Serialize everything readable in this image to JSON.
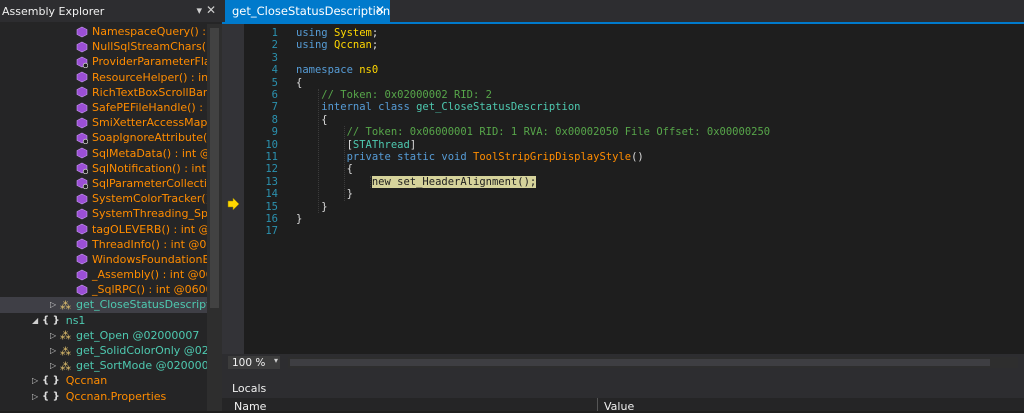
{
  "assembly_explorer": {
    "title": "Assembly Explorer",
    "items": [
      {
        "label": "NamespaceQuery() : in",
        "color": "orange",
        "indent": 0,
        "icon": "method-icon"
      },
      {
        "label": "NullSqlStreamChars() :",
        "color": "orange",
        "indent": 0,
        "icon": "method-icon"
      },
      {
        "label": "ProviderParameterFlag",
        "color": "orange",
        "indent": 0,
        "icon": "class-ref-icon"
      },
      {
        "label": "ResourceHelper() : int",
        "color": "orange",
        "indent": 0,
        "icon": "method-icon"
      },
      {
        "label": "RichTextBoxScrollBars",
        "color": "orange",
        "indent": 0,
        "icon": "method-icon"
      },
      {
        "label": "SafePEFileHandle() : st",
        "color": "orange",
        "indent": 0,
        "icon": "method-icon"
      },
      {
        "label": "SmiXetterAccessMap(",
        "color": "orange",
        "indent": 0,
        "icon": "method-icon"
      },
      {
        "label": "SoapIgnoreAttribute(A",
        "color": "orange",
        "indent": 0,
        "icon": "class-ref-icon"
      },
      {
        "label": "SqlMetaData() : int @0",
        "color": "orange",
        "indent": 0,
        "icon": "method-icon"
      },
      {
        "label": "SqlNotification() : int @",
        "color": "orange",
        "indent": 0,
        "icon": "class-ref-icon"
      },
      {
        "label": "SqlParameterCollectio",
        "color": "orange",
        "indent": 0,
        "icon": "class-ref-icon"
      },
      {
        "label": "SystemColorTracker() :",
        "color": "orange",
        "indent": 0,
        "icon": "method-icon"
      },
      {
        "label": "SystemThreading_Spin",
        "color": "orange",
        "indent": 0,
        "icon": "method-icon"
      },
      {
        "label": "tagOLEVERB() : int @0",
        "color": "orange",
        "indent": 0,
        "icon": "method-icon"
      },
      {
        "label": "ThreadInfo() : int @06",
        "color": "orange",
        "indent": 0,
        "icon": "method-icon"
      },
      {
        "label": "WindowsFoundationE",
        "color": "orange",
        "indent": 0,
        "icon": "method-icon"
      },
      {
        "label": "_Assembly() : int @06",
        "color": "orange",
        "indent": 0,
        "icon": "method-icon"
      },
      {
        "label": "_SqlRPC() : int @0600",
        "color": "orange",
        "indent": 0,
        "icon": "method-icon"
      }
    ],
    "selected_item": "get_CloseStatusDescriptio",
    "ns1_label": "ns1",
    "ns1_items": [
      {
        "label": "get_Open @02000007"
      },
      {
        "label": "get_SolidColorOnly @020"
      },
      {
        "label": "get_SortMode @0200000"
      }
    ],
    "root_items": [
      {
        "label": "Qccnan"
      },
      {
        "label": "Qccnan.Properties"
      }
    ]
  },
  "editor": {
    "tab_label": "get_CloseStatusDescription",
    "zoom": "100 %",
    "current_line": 13,
    "lines": [
      {
        "n": "1",
        "segments": [
          {
            "t": "using ",
            "c": "kw"
          },
          {
            "t": "System",
            "c": "yt"
          },
          {
            "t": ";",
            "c": "ns"
          }
        ]
      },
      {
        "n": "2",
        "segments": [
          {
            "t": "using ",
            "c": "kw"
          },
          {
            "t": "Qccnan",
            "c": "yt"
          },
          {
            "t": ";",
            "c": "ns"
          }
        ]
      },
      {
        "n": "3",
        "segments": []
      },
      {
        "n": "4",
        "segments": [
          {
            "t": "namespace ",
            "c": "kw"
          },
          {
            "t": "ns0",
            "c": "yt"
          }
        ]
      },
      {
        "n": "5",
        "segments": [
          {
            "t": "{",
            "c": "ns"
          }
        ]
      },
      {
        "n": "6",
        "segments": [
          {
            "t": "    // Token: 0x02000002 RID: 2",
            "c": "cm"
          }
        ]
      },
      {
        "n": "7",
        "segments": [
          {
            "t": "    internal class ",
            "c": "kw"
          },
          {
            "t": "get_CloseStatusDescription",
            "c": "ty"
          }
        ]
      },
      {
        "n": "8",
        "segments": [
          {
            "t": "    {",
            "c": "ns"
          }
        ]
      },
      {
        "n": "9",
        "segments": [
          {
            "t": "        // Token: 0x06000001 RID: 1 RVA: 0x00002050 File Offset: 0x00000250",
            "c": "cm"
          }
        ]
      },
      {
        "n": "10",
        "segments": [
          {
            "t": "        [",
            "c": "ns"
          },
          {
            "t": "STAThread",
            "c": "ty"
          },
          {
            "t": "]",
            "c": "ns"
          }
        ]
      },
      {
        "n": "11",
        "segments": [
          {
            "t": "        private static void ",
            "c": "kw"
          },
          {
            "t": "ToolStripGripDisplayStyle",
            "c": "orangec"
          },
          {
            "t": "()",
            "c": "ns"
          }
        ]
      },
      {
        "n": "12",
        "segments": [
          {
            "t": "        {",
            "c": "ns"
          }
        ]
      },
      {
        "n": "13",
        "segments": [
          {
            "t": "            ",
            "c": "ns"
          },
          {
            "t": "new set_HeaderAlignment();",
            "c": "hl"
          }
        ]
      },
      {
        "n": "14",
        "segments": [
          {
            "t": "        }",
            "c": "ns"
          }
        ]
      },
      {
        "n": "15",
        "segments": [
          {
            "t": "    }",
            "c": "ns"
          }
        ]
      },
      {
        "n": "16",
        "segments": [
          {
            "t": "}",
            "c": "ns"
          }
        ]
      },
      {
        "n": "17",
        "segments": []
      }
    ]
  },
  "locals": {
    "title": "Locals",
    "col_name": "Name",
    "col_value": "Value"
  }
}
